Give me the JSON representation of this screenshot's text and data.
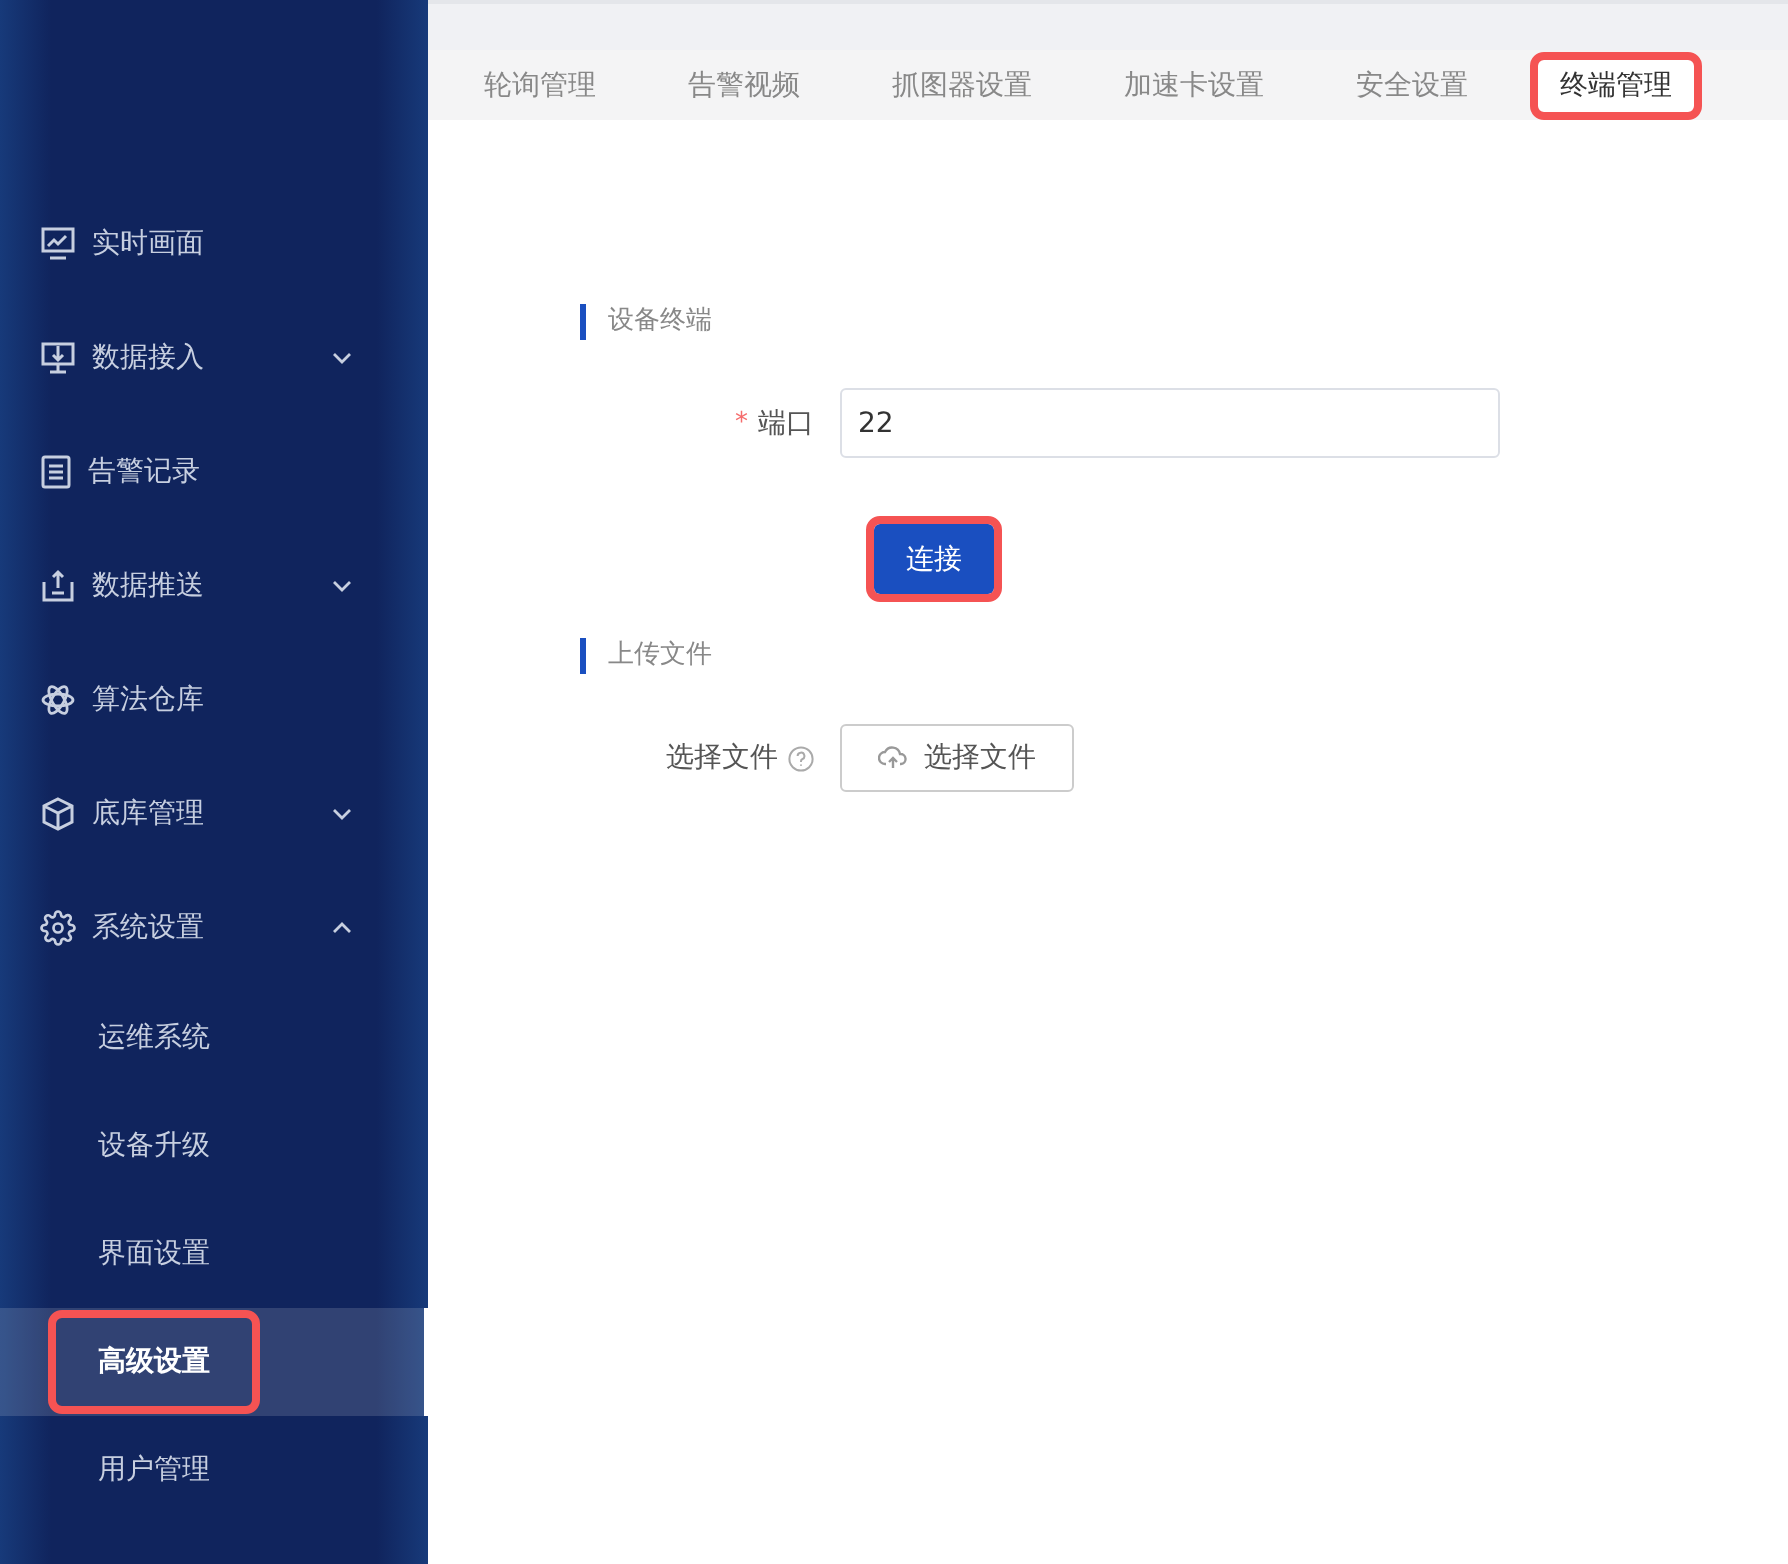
{
  "sidebar": {
    "items": [
      {
        "label": "实时画面",
        "selected": false
      },
      {
        "label": "数据接入",
        "expanded": false,
        "selected": false
      },
      {
        "label": "告警记录",
        "selected": false
      },
      {
        "label": "数据推送",
        "expanded": false,
        "selected": false
      },
      {
        "label": "算法仓库",
        "selected": false
      },
      {
        "label": "底库管理",
        "expanded": false,
        "selected": false
      },
      {
        "label": "系统设置",
        "expanded": true,
        "selected": false,
        "children": [
          {
            "label": "运维系统",
            "selected": false,
            "highlighted": false
          },
          {
            "label": "设备升级",
            "selected": false,
            "highlighted": false
          },
          {
            "label": "界面设置",
            "selected": false,
            "highlighted": false
          },
          {
            "label": "高级设置",
            "selected": true,
            "highlighted": true
          },
          {
            "label": "用户管理",
            "selected": false,
            "highlighted": false
          }
        ]
      }
    ]
  },
  "tabs": [
    {
      "label": "轮询管理",
      "selected": false,
      "highlighted": false
    },
    {
      "label": "告警视频",
      "selected": false,
      "highlighted": false
    },
    {
      "label": "抓图器设置",
      "selected": false,
      "highlighted": false
    },
    {
      "label": "加速卡设置",
      "selected": false,
      "highlighted": false
    },
    {
      "label": "安全设置",
      "selected": false,
      "highlighted": false
    },
    {
      "label": "终端管理",
      "selected": true,
      "highlighted": true
    }
  ],
  "sections": [
    {
      "title": "设备终端",
      "fields": [
        {
          "kind": "input",
          "label": "端口",
          "required_mark": "*",
          "value": "22"
        }
      ],
      "button": {
        "label": "连接",
        "highlighted": true
      }
    },
    {
      "title": "上传文件",
      "fields": [
        {
          "kind": "upload",
          "label": "选择文件",
          "help": true,
          "button": "选择文件"
        }
      ]
    }
  ]
}
